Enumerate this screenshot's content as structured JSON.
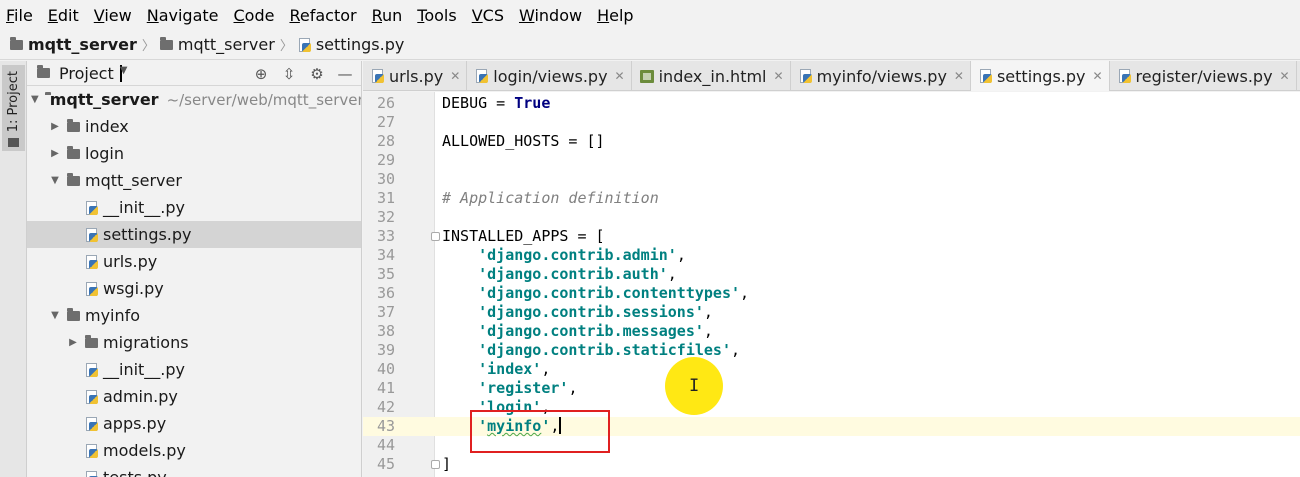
{
  "menu": [
    "File",
    "Edit",
    "View",
    "Navigate",
    "Code",
    "Refactor",
    "Run",
    "Tools",
    "VCS",
    "Window",
    "Help"
  ],
  "breadcrumb": [
    "mqtt_server",
    "mqtt_server",
    "settings.py"
  ],
  "left_strip": {
    "label": "1: Project"
  },
  "project_panel": {
    "title": "Project",
    "tree": [
      {
        "label": "mqtt_server",
        "path": "~/server/web/mqtt_server",
        "type": "folder",
        "depth": 0,
        "expanded": true,
        "bold": true
      },
      {
        "label": "index",
        "type": "folder",
        "depth": 1,
        "expanded": false
      },
      {
        "label": "login",
        "type": "folder",
        "depth": 1,
        "expanded": false
      },
      {
        "label": "mqtt_server",
        "type": "folder",
        "depth": 1,
        "expanded": true
      },
      {
        "label": "__init__.py",
        "type": "py",
        "depth": 2
      },
      {
        "label": "settings.py",
        "type": "py",
        "depth": 2,
        "selected": true
      },
      {
        "label": "urls.py",
        "type": "py",
        "depth": 2
      },
      {
        "label": "wsgi.py",
        "type": "py",
        "depth": 2
      },
      {
        "label": "myinfo",
        "type": "folder",
        "depth": 1,
        "expanded": true
      },
      {
        "label": "migrations",
        "type": "folder",
        "depth": 2,
        "expanded": false
      },
      {
        "label": "__init__.py",
        "type": "py",
        "depth": 2
      },
      {
        "label": "admin.py",
        "type": "py",
        "depth": 2
      },
      {
        "label": "apps.py",
        "type": "py",
        "depth": 2
      },
      {
        "label": "models.py",
        "type": "py",
        "depth": 2
      },
      {
        "label": "tests.py",
        "type": "py",
        "depth": 2
      }
    ]
  },
  "tabs": [
    {
      "label": "urls.py",
      "icon": "python-file-icon",
      "active": false
    },
    {
      "label": "login/views.py",
      "icon": "python-file-icon",
      "active": false
    },
    {
      "label": "index_in.html",
      "icon": "html-file-icon",
      "active": false
    },
    {
      "label": "myinfo/views.py",
      "icon": "python-file-icon",
      "active": false
    },
    {
      "label": "settings.py",
      "icon": "python-file-icon",
      "active": true
    },
    {
      "label": "register/views.py",
      "icon": "python-file-icon",
      "active": false
    }
  ],
  "editor": {
    "lines": [
      {
        "n": "26",
        "tokens": [
          [
            "plain",
            "DEBUG = "
          ],
          [
            "kw",
            "True"
          ]
        ]
      },
      {
        "n": "27",
        "tokens": []
      },
      {
        "n": "28",
        "tokens": [
          [
            "plain",
            "ALLOWED_HOSTS = []"
          ]
        ]
      },
      {
        "n": "29",
        "tokens": []
      },
      {
        "n": "30",
        "tokens": []
      },
      {
        "n": "31",
        "tokens": [
          [
            "cmt",
            "# Application definition"
          ]
        ]
      },
      {
        "n": "32",
        "tokens": []
      },
      {
        "n": "33",
        "tokens": [
          [
            "plain",
            "INSTALLED_APPS = ["
          ]
        ],
        "fold": true
      },
      {
        "n": "34",
        "tokens": [
          [
            "plain",
            "    "
          ],
          [
            "str",
            "'django.contrib.admin'"
          ],
          [
            "plain",
            ","
          ]
        ]
      },
      {
        "n": "35",
        "tokens": [
          [
            "plain",
            "    "
          ],
          [
            "str",
            "'django.contrib.auth'"
          ],
          [
            "plain",
            ","
          ]
        ]
      },
      {
        "n": "36",
        "tokens": [
          [
            "plain",
            "    "
          ],
          [
            "str",
            "'django.contrib.contenttypes'"
          ],
          [
            "plain",
            ","
          ]
        ]
      },
      {
        "n": "37",
        "tokens": [
          [
            "plain",
            "    "
          ],
          [
            "str",
            "'django.contrib.sessions'"
          ],
          [
            "plain",
            ","
          ]
        ]
      },
      {
        "n": "38",
        "tokens": [
          [
            "plain",
            "    "
          ],
          [
            "str",
            "'django.contrib.messages'"
          ],
          [
            "plain",
            ","
          ]
        ]
      },
      {
        "n": "39",
        "tokens": [
          [
            "plain",
            "    "
          ],
          [
            "str",
            "'django.contrib.staticfiles'"
          ],
          [
            "plain",
            ","
          ]
        ]
      },
      {
        "n": "40",
        "tokens": [
          [
            "plain",
            "    "
          ],
          [
            "str",
            "'index'"
          ],
          [
            "plain",
            ","
          ]
        ]
      },
      {
        "n": "41",
        "tokens": [
          [
            "plain",
            "    "
          ],
          [
            "str",
            "'register'"
          ],
          [
            "plain",
            ","
          ]
        ]
      },
      {
        "n": "42",
        "tokens": [
          [
            "plain",
            "    "
          ],
          [
            "str",
            "'login'"
          ],
          [
            "plain",
            ","
          ]
        ]
      },
      {
        "n": "43",
        "tokens": [
          [
            "plain",
            "    "
          ],
          [
            "str",
            "'"
          ],
          [
            "str squig",
            "myinfo"
          ],
          [
            "str",
            "'"
          ],
          [
            "plain",
            ","
          ],
          [
            "caret",
            ""
          ]
        ],
        "current": true
      },
      {
        "n": "44",
        "tokens": []
      },
      {
        "n": "45",
        "tokens": [
          [
            "plain",
            "]"
          ]
        ],
        "fold": true
      }
    ]
  },
  "colors": {
    "selection": "#d4d4d4",
    "current_line": "#fffbe0",
    "string": "#008080",
    "keyword": "#000080",
    "comment": "#808080",
    "highlight_box": "#e02020",
    "cursor_spot": "#ffe600"
  }
}
